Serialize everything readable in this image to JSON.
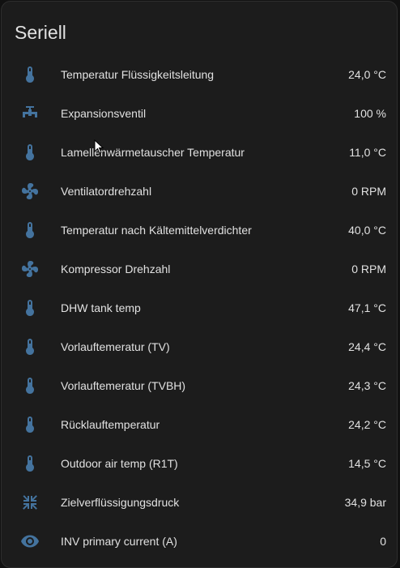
{
  "card": {
    "title": "Seriell"
  },
  "colors": {
    "icon": "#44739e",
    "background": "#1c1c1c",
    "text": "#e1e1e1"
  },
  "rows": [
    {
      "icon": "thermometer-icon",
      "label": "Temperatur Flüssigkeitsleitung",
      "value": "24,0 °C"
    },
    {
      "icon": "valve-icon",
      "label": "Expansionsventil",
      "value": "100 %"
    },
    {
      "icon": "thermometer-icon",
      "label": "Lamellenwärmetauscher Temperatur",
      "value": "11,0 °C"
    },
    {
      "icon": "fan-icon",
      "label": "Ventilatordrehzahl",
      "value": "0 RPM"
    },
    {
      "icon": "thermometer-icon",
      "label": "Temperatur nach Kältemittelverdichter",
      "value": "40,0 °C"
    },
    {
      "icon": "fan-icon",
      "label": "Kompressor Drehzahl",
      "value": "0 RPM"
    },
    {
      "icon": "thermometer-icon",
      "label": "DHW tank temp",
      "value": "47,1 °C"
    },
    {
      "icon": "thermometer-icon",
      "label": "Vorlauftemeratur (TV)",
      "value": "24,4 °C"
    },
    {
      "icon": "thermometer-icon",
      "label": "Vorlauftemeratur (TVBH)",
      "value": "24,3 °C"
    },
    {
      "icon": "thermometer-icon",
      "label": "Rücklauftemperatur",
      "value": "24,2 °C"
    },
    {
      "icon": "thermometer-icon",
      "label": "Outdoor air temp (R1T)",
      "value": "14,5 °C"
    },
    {
      "icon": "arrow-collapse-all-icon",
      "label": "Zielverflüssigungsdruck",
      "value": "34,9 bar"
    },
    {
      "icon": "eye-icon",
      "label": "INV primary current (A)",
      "value": "0"
    }
  ]
}
